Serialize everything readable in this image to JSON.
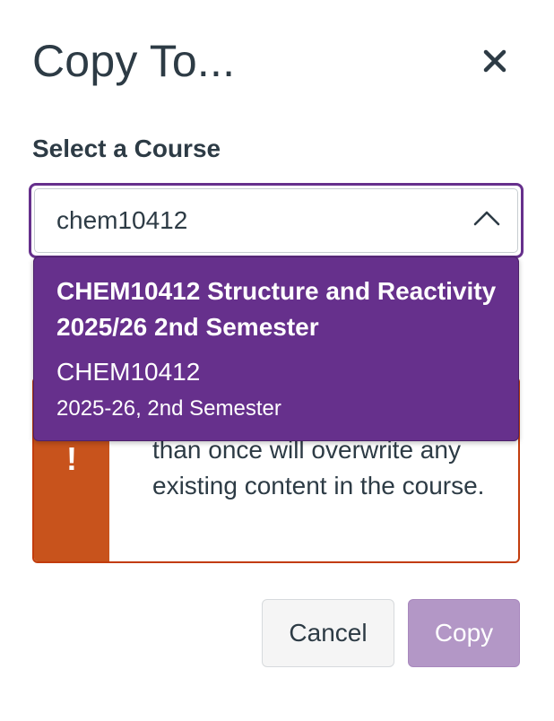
{
  "dialog": {
    "title": "Copy To...",
    "close_icon": "close-icon"
  },
  "course_select": {
    "label": "Select a Course",
    "value": "chem10412",
    "toggle_icon": "chevron-up-icon",
    "options": [
      {
        "name": "CHEM10412 Structure and Reactivity 2025/26 2nd Semester",
        "code": "CHEM10412",
        "term": "2025-26, 2nd Semester",
        "highlighted": true
      }
    ]
  },
  "alert": {
    "icon": "warning-icon",
    "visible_text": "than once will overwrite any existing content in the course.",
    "stripe_color": "#c8531c"
  },
  "footer": {
    "cancel_label": "Cancel",
    "copy_label": "Copy",
    "copy_enabled": false
  },
  "colors": {
    "accent": "#66308c",
    "text": "#2d3b45",
    "warning": "#c23c0d",
    "disabled_primary": "#b397c6"
  }
}
